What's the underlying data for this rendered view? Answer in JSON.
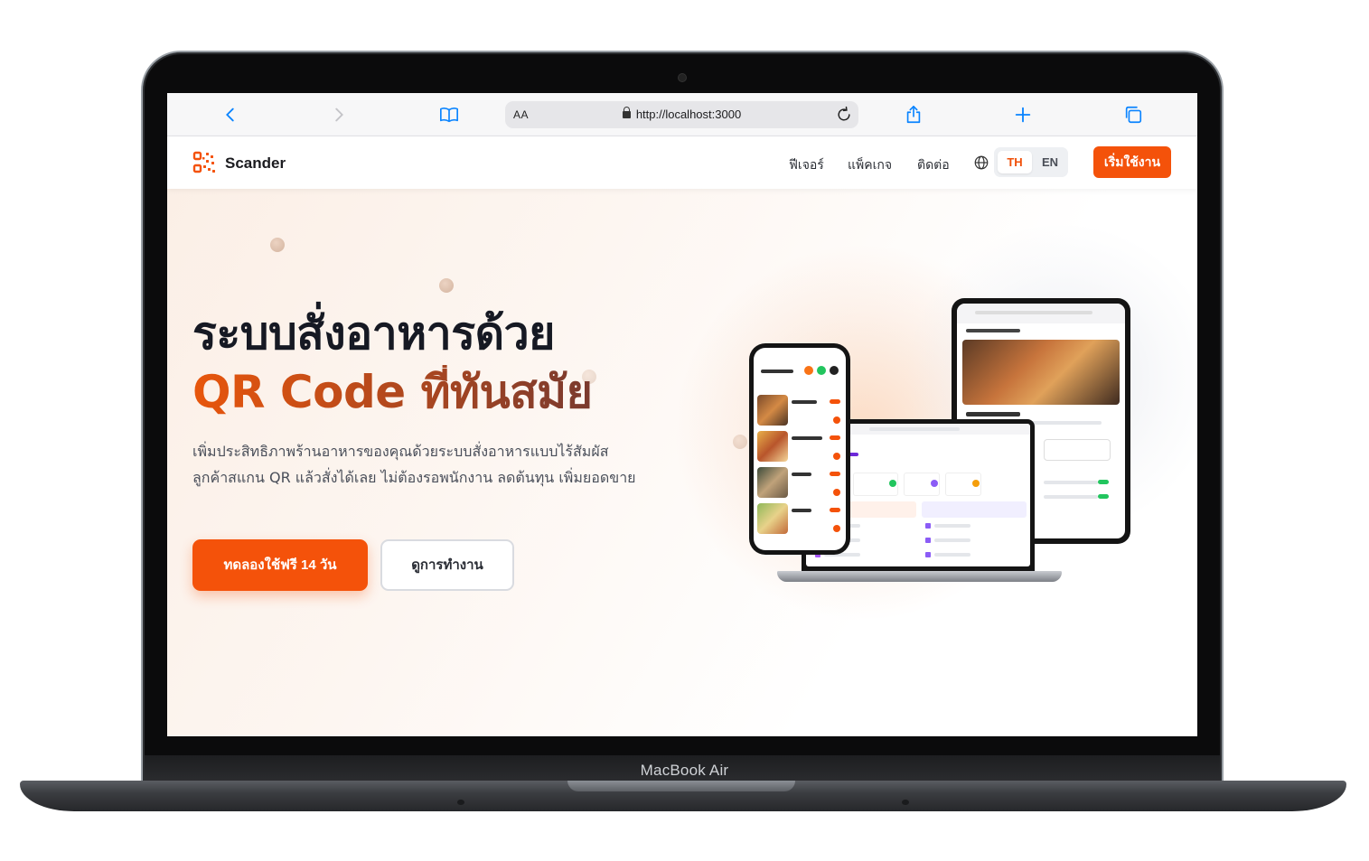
{
  "device": {
    "label": "MacBook Air"
  },
  "browser": {
    "address_prefix": "AA",
    "url": "http://localhost:3000"
  },
  "nav": {
    "brand": "Scander",
    "links": [
      "ฟีเจอร์",
      "แพ็คเกจ",
      "ติดต่อ"
    ],
    "lang_th": "TH",
    "lang_en": "EN",
    "cta": "เริ่มใช้งาน"
  },
  "hero": {
    "title_line1": "ระบบสั่งอาหารด้วย",
    "title_line2": "QR Code ที่ทันสมัย",
    "description": "เพิ่มประสิทธิภาพร้านอาหารของคุณด้วยระบบสั่งอาหารแบบไร้สัมผัส ลูกค้าสแกน QR แล้วสั่งได้เลย ไม่ต้องรอพนักงาน ลดต้นทุน เพิ่มยอดขาย",
    "primary_button": "ทดลองใช้ฟรี 14 วัน",
    "secondary_button": "ดูการทำงาน"
  },
  "colors": {
    "accent": "#f4520a",
    "text_dark": "#161923",
    "link_blue": "#0a84ff"
  }
}
